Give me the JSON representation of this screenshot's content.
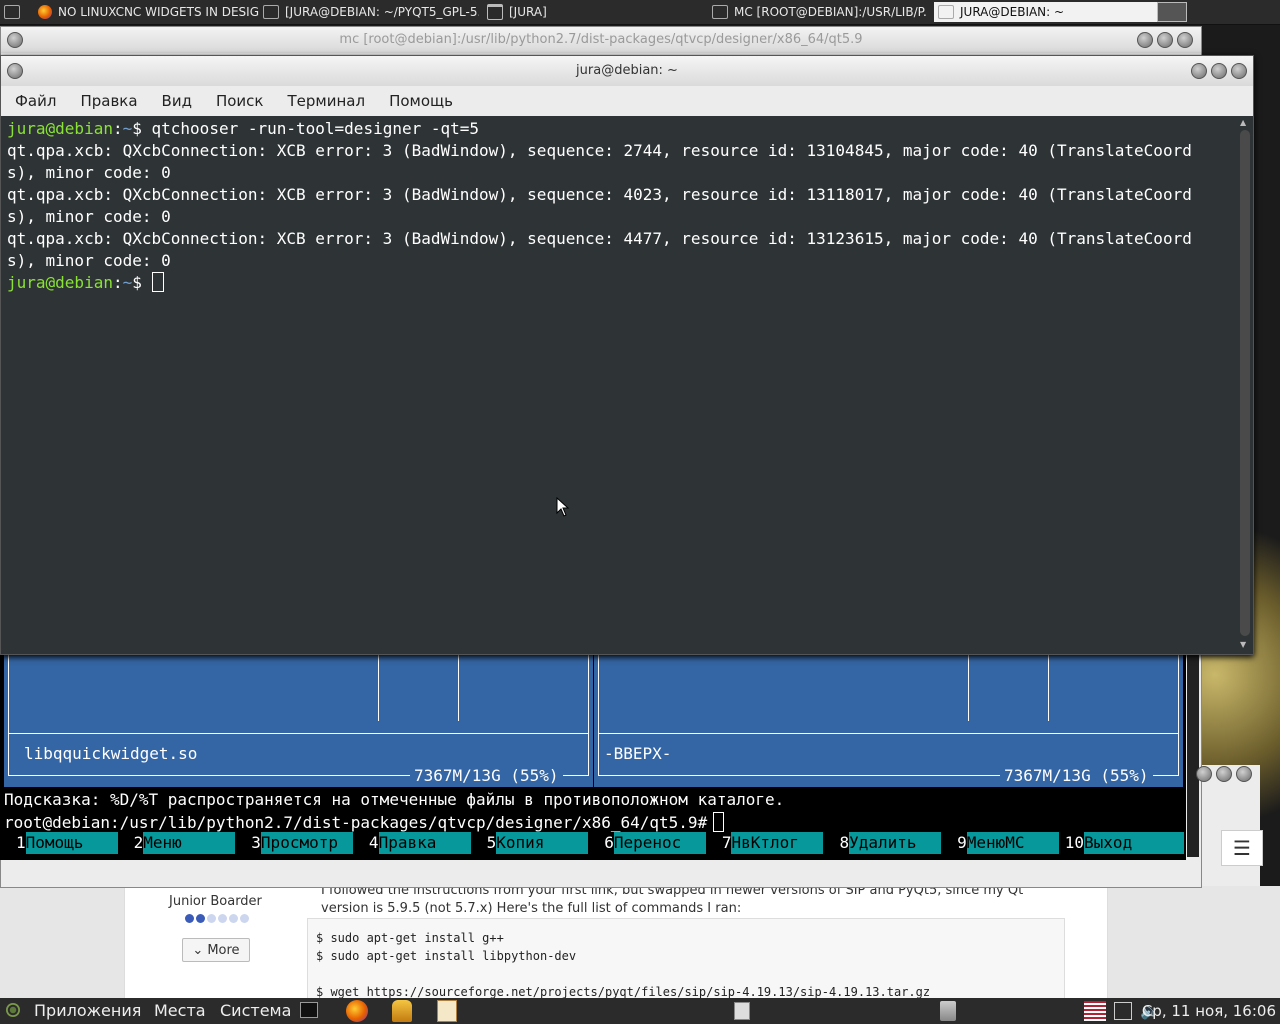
{
  "taskbar": {
    "tasks": [
      {
        "label": "NO LINUXCNC WIDGETS IN DESIGN...",
        "icon": "firefox-icon"
      },
      {
        "label": "[JURA@DEBIAN: ~/PYQT5_GPL-5....",
        "icon": "terminal-icon"
      },
      {
        "label": "[JURA]",
        "icon": "folder-icon"
      },
      {
        "label": "MC [ROOT@DEBIAN]:/USR/LIB/P...",
        "icon": "terminal-icon"
      },
      {
        "label": "JURA@DEBIAN: ~",
        "icon": "terminal-icon"
      }
    ]
  },
  "mc": {
    "title": "mc [root@debian]:/usr/lib/python2.7/dist-packages/qtvcp/designer/x86_64/qt5.9",
    "left_panel": {
      "file": "libqquickwidget.so",
      "stats": "7367M/13G (55%)"
    },
    "right_panel": {
      "file": "-ВВЕРХ-",
      "stats": "7367M/13G (55%)"
    },
    "hint": "Подсказка: %D/%T распространяется на отмеченные файлы в противоположном каталоге.",
    "cmdline": "root@debian:/usr/lib/python2.7/dist-packages/qtvcp/designer/x86_64/qt5.9#",
    "fkeys": [
      {
        "num": "1",
        "label": "Помощь"
      },
      {
        "num": "2",
        "label": "Меню"
      },
      {
        "num": "3",
        "label": "Просмотр"
      },
      {
        "num": "4",
        "label": "Правка"
      },
      {
        "num": "5",
        "label": "Копия"
      },
      {
        "num": "6",
        "label": "Перенос"
      },
      {
        "num": "7",
        "label": "НвКтлог"
      },
      {
        "num": "8",
        "label": "Удалить"
      },
      {
        "num": "9",
        "label": "МенюМС"
      },
      {
        "num": "10",
        "label": "Выход"
      }
    ]
  },
  "terminal": {
    "title": "jura@debian: ~",
    "menu": [
      "Файл",
      "Правка",
      "Вид",
      "Поиск",
      "Терминал",
      "Помощь"
    ],
    "prompt_user": "jura@debian",
    "prompt_sep": ":",
    "prompt_path": "~",
    "prompt_end": "$ ",
    "command": "qtchooser -run-tool=designer -qt=5",
    "output": [
      "qt.qpa.xcb: QXcbConnection: XCB error: 3 (BadWindow), sequence: 2744, resource id: 13104845, major code: 40 (TranslateCoord",
      "s), minor code: 0",
      "qt.qpa.xcb: QXcbConnection: XCB error: 3 (BadWindow), sequence: 4023, resource id: 13118017, major code: 40 (TranslateCoord",
      "s), minor code: 0",
      "qt.qpa.xcb: QXcbConnection: XCB error: 3 (BadWindow), sequence: 4477, resource id: 13123615, major code: 40 (TranslateCoord",
      "s), minor code: 0"
    ]
  },
  "webpage": {
    "post_text": "I followed the instructions from your first link, but swapped in newer versions of SIP and PyQt5, since my Qt version is 5.9.5 (not 5.7.x) Here's the full list of commands I ran:",
    "code": [
      "$ sudo apt-get install g++",
      "$ sudo apt-get install libpython-dev",
      "$ wget https://sourceforge.net/projects/pyqt/files/sip/sip-4.19.13/sip-4.19.13.tar.gz"
    ],
    "user_rank": "Junior Boarder",
    "rank_level": 2,
    "rank_max": 6,
    "more_label": "More",
    "menu_icon": "hamburger-icon"
  },
  "bottom_panel": {
    "menus": [
      "Приложения",
      "Места",
      "Система"
    ],
    "clock": "Ср, 11 ноя, 16:06"
  }
}
